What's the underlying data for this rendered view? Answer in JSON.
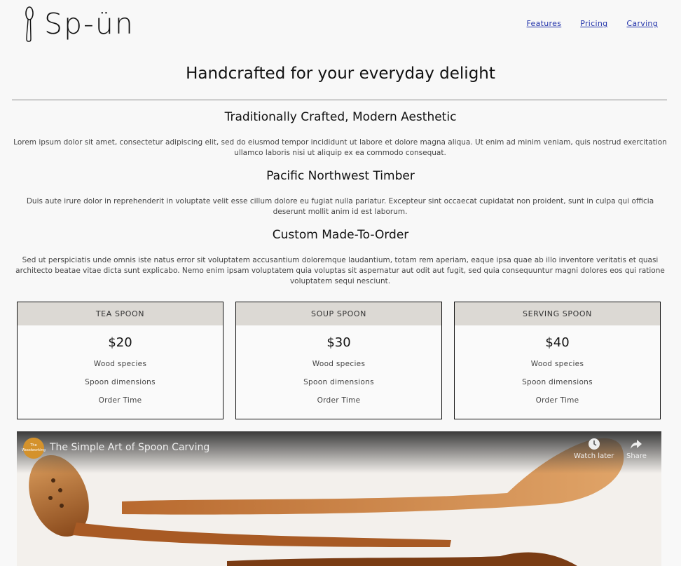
{
  "header": {
    "logo_text": "Sp-ün",
    "nav": [
      "Features",
      "Pricing",
      "Carving"
    ]
  },
  "hero": {
    "title": "Handcrafted for your everyday delight"
  },
  "features": [
    {
      "title": "Traditionally Crafted, Modern Aesthetic",
      "body": "Lorem ipsum dolor sit amet, consectetur adipiscing elit, sed do eiusmod tempor incididunt ut labore et dolore magna aliqua. Ut enim ad minim veniam, quis nostrud exercitation ullamco laboris nisi ut aliquip ex ea commodo consequat."
    },
    {
      "title": "Pacific Northwest Timber",
      "body": "Duis aute irure dolor in reprehenderit in voluptate velit esse cillum dolore eu fugiat nulla pariatur. Excepteur sint occaecat cupidatat non proident, sunt in culpa qui officia deserunt mollit anim id est laborum."
    },
    {
      "title": "Custom Made-To-Order",
      "body": "Sed ut perspiciatis unde omnis iste natus error sit voluptatem accusantium doloremque laudantium, totam rem aperiam, eaque ipsa quae ab illo inventore veritatis et quasi architecto beatae vitae dicta sunt explicabo. Nemo enim ipsam voluptatem quia voluptas sit aspernatur aut odit aut fugit, sed quia consequuntur magni dolores eos qui ratione voluptatem sequi nesciunt."
    }
  ],
  "pricing": [
    {
      "name": "TEA SPOON",
      "price": "$20",
      "items": [
        "Wood species",
        "Spoon dimensions",
        "Order Time"
      ]
    },
    {
      "name": "SOUP SPOON",
      "price": "$30",
      "items": [
        "Wood species",
        "Spoon dimensions",
        "Order Time"
      ]
    },
    {
      "name": "SERVING SPOON",
      "price": "$40",
      "items": [
        "Wood species",
        "Spoon dimensions",
        "Order Time"
      ]
    }
  ],
  "video": {
    "title": "The Simple Art of Spoon Carving",
    "channel_badge": "The Woodworking",
    "watch_later": "Watch later",
    "share": "Share"
  }
}
